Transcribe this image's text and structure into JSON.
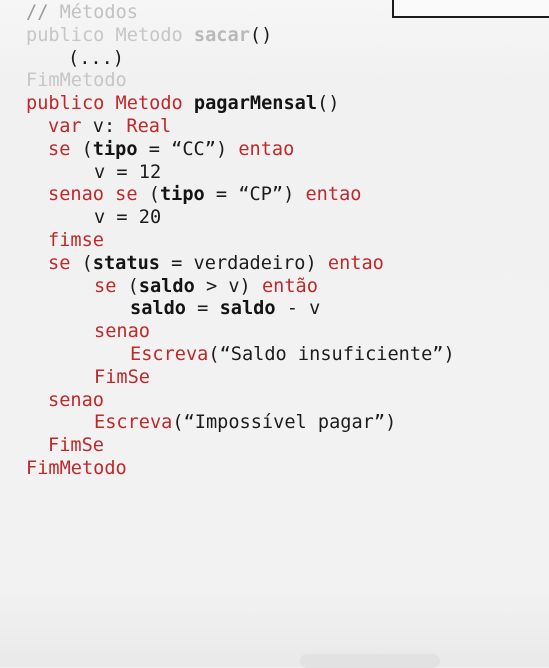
{
  "lines": [
    {
      "parts": [
        {
          "t": "// ",
          "c": "cm-slash"
        },
        {
          "t": "Métodos",
          "c": "cm"
        }
      ],
      "indent": "",
      "faded": true
    },
    {
      "parts": [
        {
          "t": "publico Metodo ",
          "c": "kw"
        },
        {
          "t": "sacar",
          "c": "b"
        },
        {
          "t": "()",
          "c": "id"
        }
      ],
      "indent": "",
      "faded": true
    },
    {
      "parts": [
        {
          "t": "(...)",
          "c": "id"
        }
      ],
      "indent": "i2",
      "faded": true
    },
    {
      "parts": [
        {
          "t": "FimMetodo",
          "c": "kw"
        }
      ],
      "indent": "",
      "faded": true
    },
    {
      "parts": [
        {
          "t": "publico Metodo ",
          "c": "kw"
        },
        {
          "t": "pagarMensal",
          "c": "b"
        },
        {
          "t": "()",
          "c": "id"
        }
      ],
      "indent": ""
    },
    {
      "parts": [
        {
          "t": "var ",
          "c": "kw"
        },
        {
          "t": "v: ",
          "c": "id"
        },
        {
          "t": "Real",
          "c": "kw"
        }
      ],
      "indent": "i1"
    },
    {
      "parts": [
        {
          "t": "se ",
          "c": "kw"
        },
        {
          "t": "(",
          "c": "id"
        },
        {
          "t": "tipo",
          "c": "b"
        },
        {
          "t": " = “CC”) ",
          "c": "id"
        },
        {
          "t": "entao",
          "c": "kw"
        }
      ],
      "indent": "i1"
    },
    {
      "parts": [
        {
          "t": "v = 12",
          "c": "id"
        }
      ],
      "indent": "i6"
    },
    {
      "parts": [
        {
          "t": "senao se ",
          "c": "kw"
        },
        {
          "t": "(",
          "c": "id"
        },
        {
          "t": "tipo",
          "c": "b"
        },
        {
          "t": " = “CP”) ",
          "c": "id"
        },
        {
          "t": "entao",
          "c": "kw"
        }
      ],
      "indent": "i1"
    },
    {
      "parts": [
        {
          "t": "v = 20",
          "c": "id"
        }
      ],
      "indent": "i6"
    },
    {
      "parts": [
        {
          "t": "fimse",
          "c": "kw"
        }
      ],
      "indent": "i1"
    },
    {
      "parts": [
        {
          "t": "se ",
          "c": "kw"
        },
        {
          "t": "(",
          "c": "id"
        },
        {
          "t": "status",
          "c": "b"
        },
        {
          "t": " = verdadeiro) ",
          "c": "id"
        },
        {
          "t": "entao",
          "c": "kw"
        }
      ],
      "indent": "i1"
    },
    {
      "parts": [
        {
          "t": "se ",
          "c": "kw"
        },
        {
          "t": "(",
          "c": "id"
        },
        {
          "t": "saldo",
          "c": "b"
        },
        {
          "t": " > v) ",
          "c": "id"
        },
        {
          "t": "então",
          "c": "kw"
        }
      ],
      "indent": "i6"
    },
    {
      "parts": [
        {
          "t": "saldo",
          "c": "b"
        },
        {
          "t": " = ",
          "c": "id"
        },
        {
          "t": "saldo",
          "c": "b"
        },
        {
          "t": " - v",
          "c": "id"
        }
      ],
      "indent": "i4"
    },
    {
      "parts": [
        {
          "t": "senao",
          "c": "kw"
        }
      ],
      "indent": "i6"
    },
    {
      "parts": [
        {
          "t": "Escreva",
          "c": "kw"
        },
        {
          "t": "(“Saldo insuficiente”)",
          "c": "id"
        }
      ],
      "indent": "i4"
    },
    {
      "parts": [
        {
          "t": "FimSe",
          "c": "kw"
        }
      ],
      "indent": "i6"
    },
    {
      "parts": [
        {
          "t": "senao",
          "c": "kw"
        }
      ],
      "indent": "i1"
    },
    {
      "parts": [
        {
          "t": "Escreva",
          "c": "kw"
        },
        {
          "t": "(“Impossível pagar”)",
          "c": "id"
        }
      ],
      "indent": "i6"
    },
    {
      "parts": [
        {
          "t": "FimSe",
          "c": "kw"
        }
      ],
      "indent": "i1"
    },
    {
      "parts": [
        {
          "t": "FimMetodo",
          "c": "kw"
        }
      ],
      "indent": ""
    }
  ]
}
